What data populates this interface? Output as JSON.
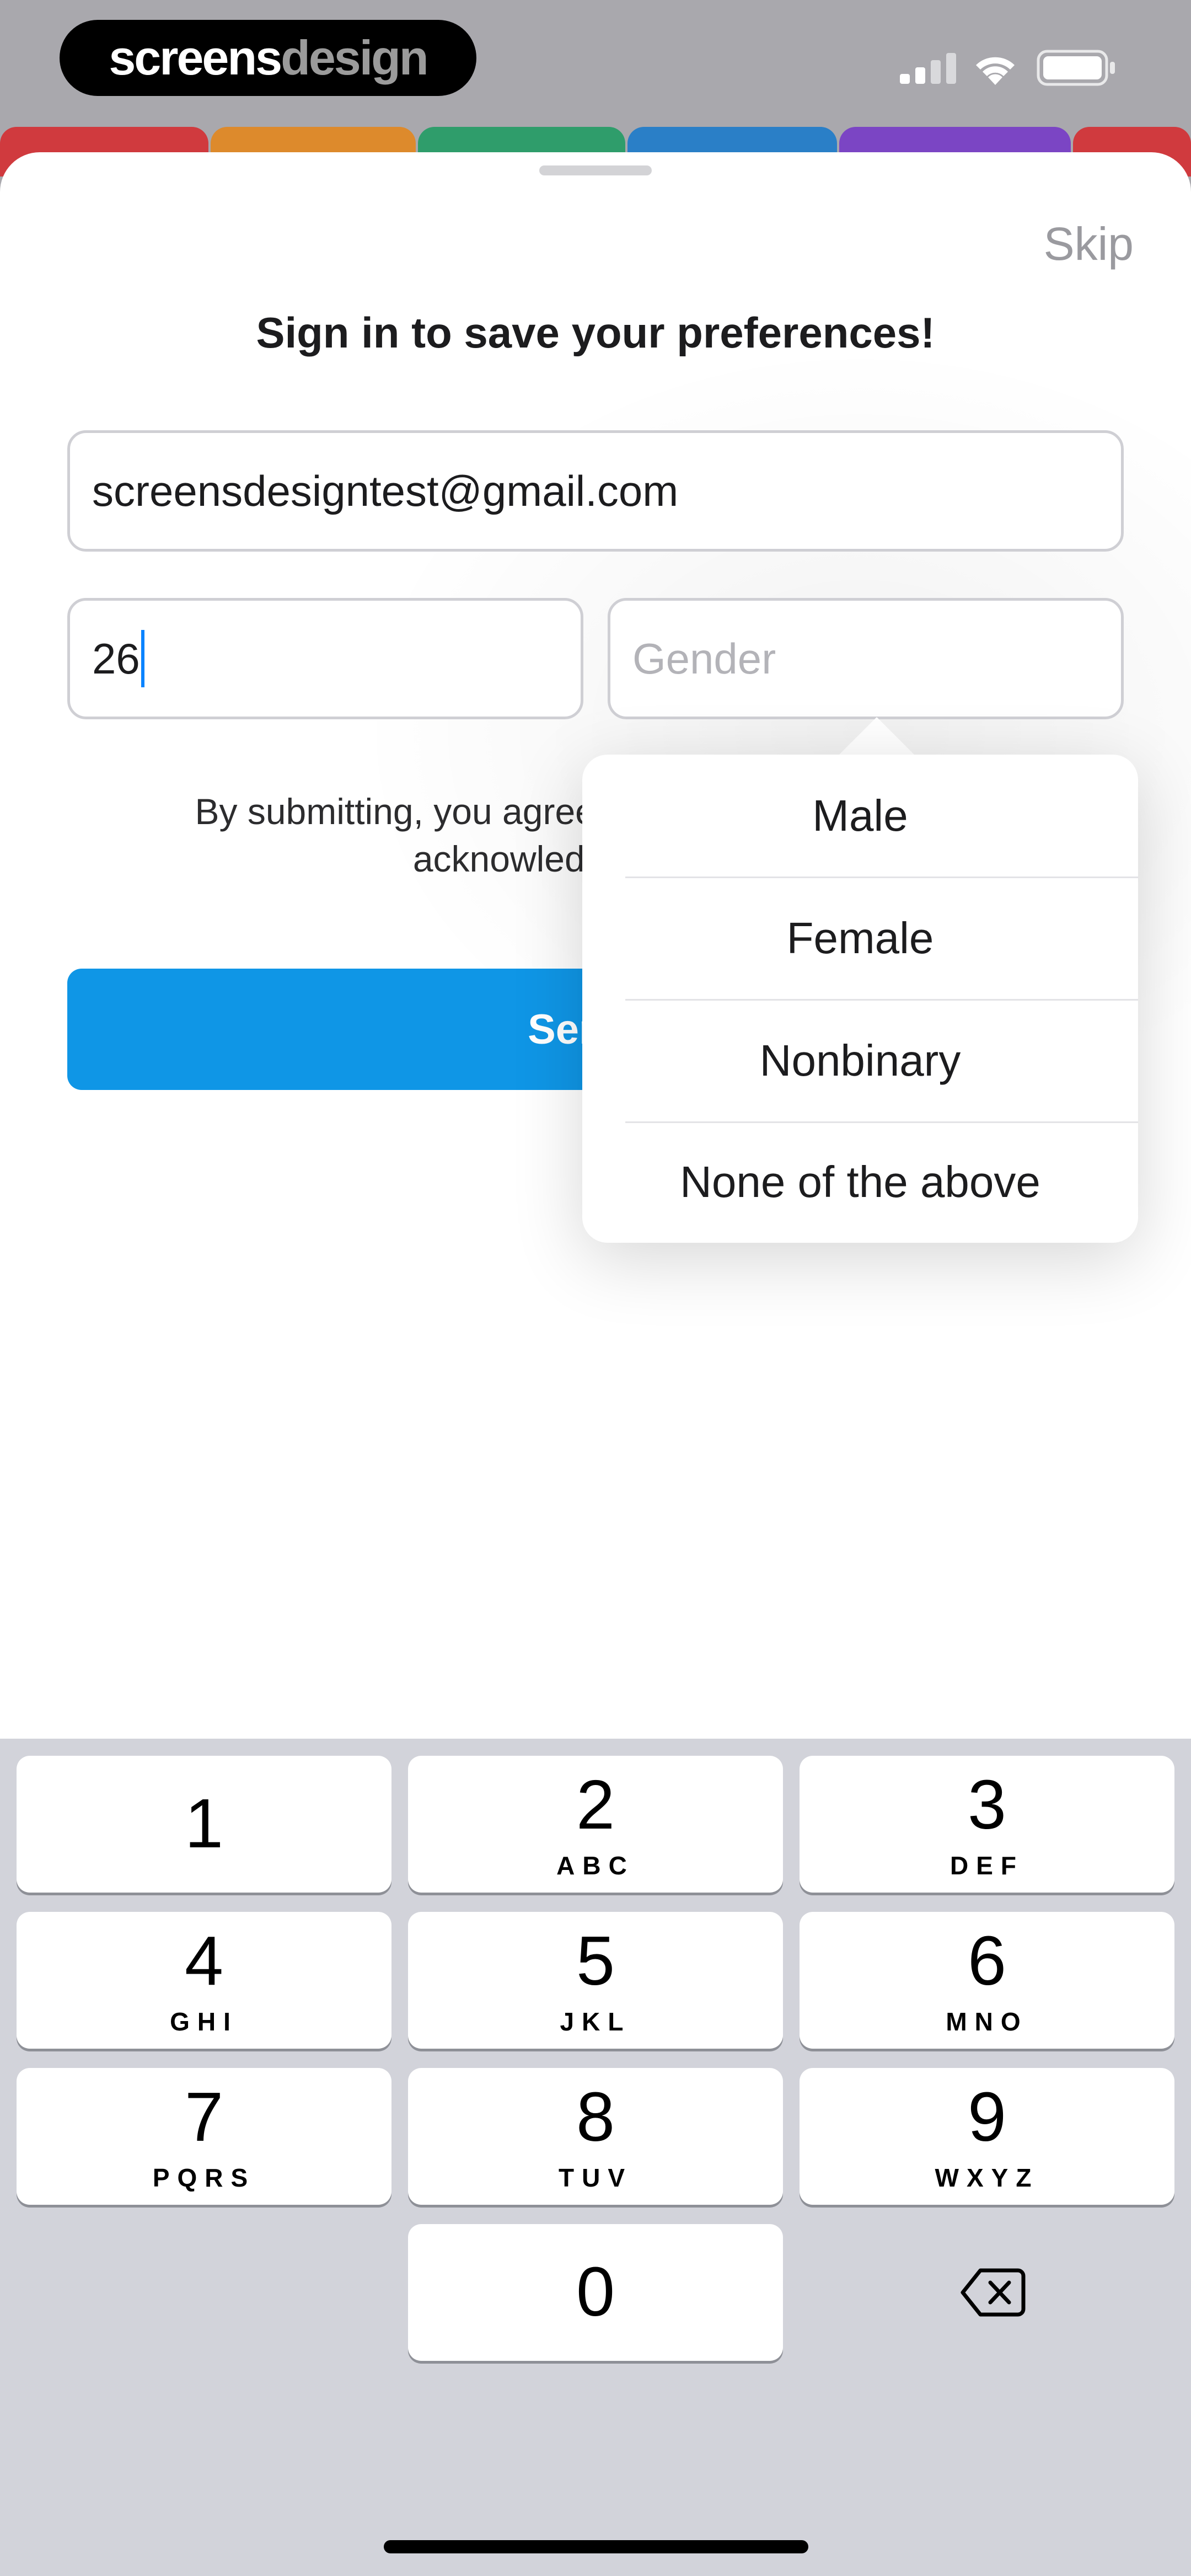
{
  "brand": {
    "part_a": "screens",
    "part_b": "design"
  },
  "tabs_colors": [
    "#d03a3e",
    "#dd8a2c",
    "#2f9d6b",
    "#2a7fc7",
    "#7b45c4",
    "#d03a3e"
  ],
  "sheet": {
    "skip_label": "Skip",
    "title": "Sign in to save your preferences!",
    "email_value": "screensdesigntest@gmail.com",
    "age_value": "26",
    "gender_placeholder": "Gender",
    "legal_line1": "By submitting, you agree t",
    "legal_line2": "acknowledge o",
    "send_label": "Send"
  },
  "gender_options": [
    "Male",
    "Female",
    "Nonbinary",
    "None of the above"
  ],
  "keyboard": {
    "keys": [
      {
        "digit": "1",
        "letters": ""
      },
      {
        "digit": "2",
        "letters": "ABC"
      },
      {
        "digit": "3",
        "letters": "DEF"
      },
      {
        "digit": "4",
        "letters": "GHI"
      },
      {
        "digit": "5",
        "letters": "JKL"
      },
      {
        "digit": "6",
        "letters": "MNO"
      },
      {
        "digit": "7",
        "letters": "PQRS"
      },
      {
        "digit": "8",
        "letters": "TUV"
      },
      {
        "digit": "9",
        "letters": "WXYZ"
      },
      {
        "digit": "0",
        "letters": ""
      }
    ],
    "delete_icon": "delete-backspace-icon"
  },
  "colors": {
    "accent": "#0f96e6",
    "caret": "#0a84ff",
    "keyboard_bg": "#d2d3da"
  }
}
